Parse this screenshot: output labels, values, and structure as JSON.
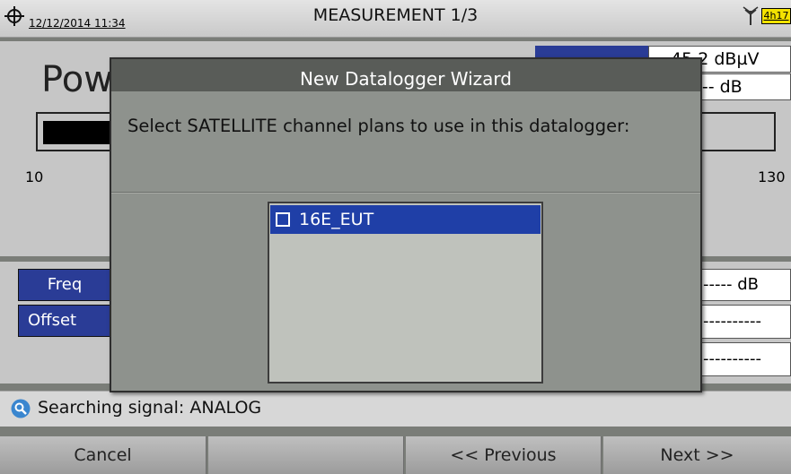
{
  "status_bar": {
    "datetime": "12/12/2014 11:34",
    "title": "MEASUREMENT 1/3",
    "battery": "4h17",
    "icons": [
      "target-icon",
      "antenna-icon"
    ]
  },
  "measurement": {
    "title": "Pow",
    "band_label": "",
    "power_value": "45.2 dBµV",
    "ratio_value": "--- dB",
    "scale_min": "10",
    "scale_max": "130",
    "freq_label": "Freq",
    "offset_label": "Offset",
    "field_db": "----- dB",
    "field_dash1": "----------",
    "field_dash2": "----------"
  },
  "search": {
    "status": "Searching signal: ANALOG",
    "icon": "search-icon"
  },
  "softkeys": {
    "cancel": "Cancel",
    "empty": "",
    "previous": "<< Previous",
    "next": "Next >>"
  },
  "dialog": {
    "title": "New Datalogger Wizard",
    "message": "Select SATELLITE channel plans to use in this datalogger:",
    "plans": [
      {
        "name": "16E_EUT",
        "checked": false,
        "selected": true
      }
    ]
  },
  "colors": {
    "accent_blue": "#2a3c96",
    "selection_blue": "#1f3fa7",
    "battery_yellow": "#f4e200"
  }
}
